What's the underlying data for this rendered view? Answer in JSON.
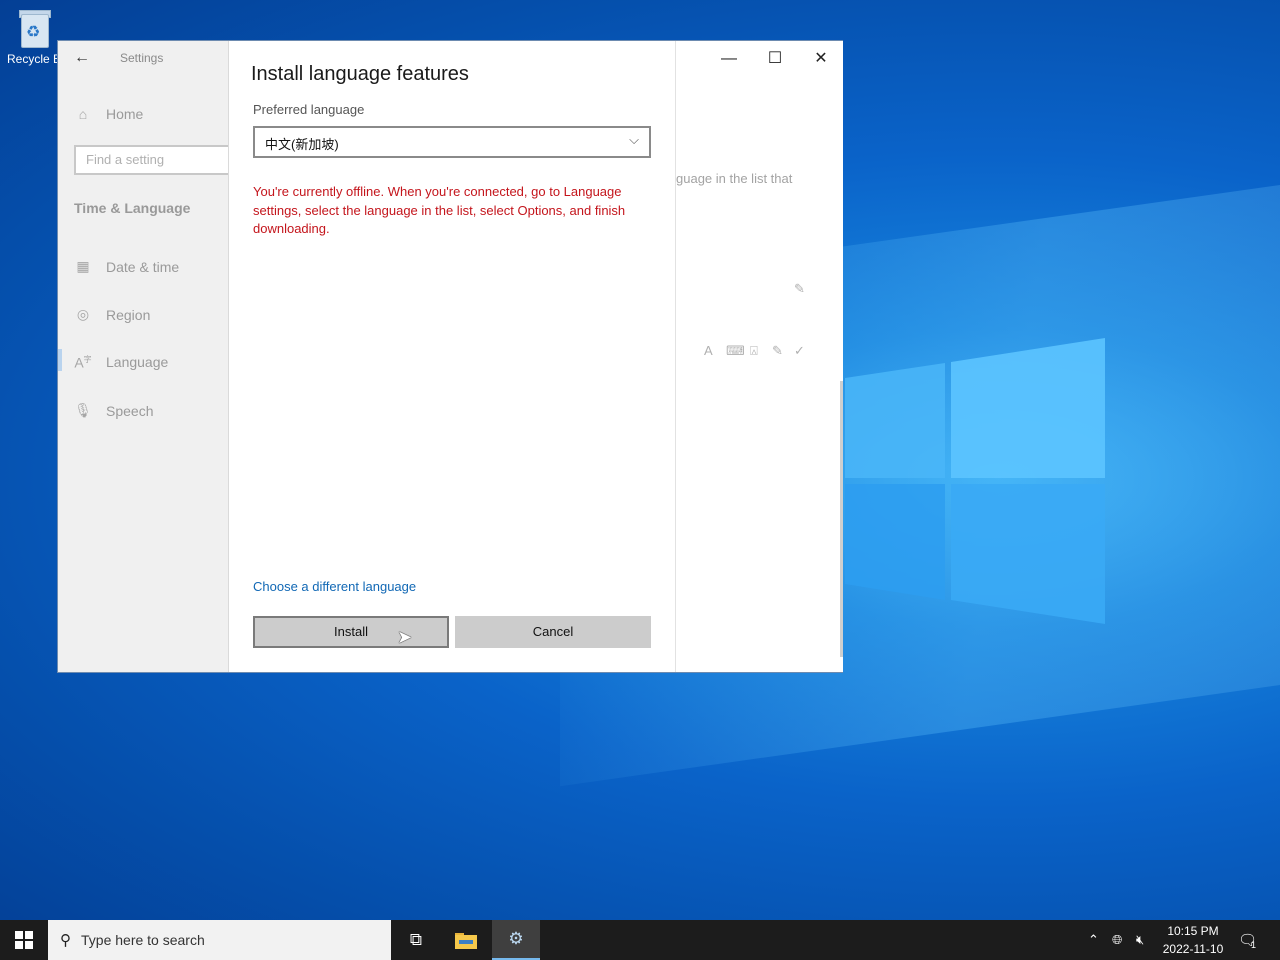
{
  "desktop": {
    "icons": [
      {
        "label": "Recycle Bin",
        "visible_label": "Recycle B"
      }
    ]
  },
  "settings": {
    "app_title": "Settings",
    "back_icon": "back-arrow-icon",
    "search_placeholder": "Find a setting",
    "home_label": "Home",
    "section_title": "Time & Language",
    "nav_items": [
      {
        "label": "Date & time",
        "icon": "calendar-clock-icon"
      },
      {
        "label": "Region",
        "icon": "globe-icon"
      },
      {
        "label": "Language",
        "icon": "language-icon",
        "selected": true
      },
      {
        "label": "Speech",
        "icon": "microphone-icon"
      }
    ],
    "window_controls": {
      "minimize": "—",
      "maximize": "☐",
      "close": "✕"
    },
    "background_text": "guage in the list that"
  },
  "dialog": {
    "title": "Install language features",
    "preferred_label": "Preferred language",
    "selected_language": "中文(新加坡)",
    "offline_message": "You're currently offline. When you're connected, go to Language settings, select the language in the list, select Options, and finish downloading.",
    "change_link": "Choose a different language",
    "install_button": "Install",
    "cancel_button": "Cancel",
    "error_color": "#c4151c",
    "link_color": "#1168b5"
  },
  "taskbar": {
    "search_placeholder": "Type here to search",
    "time": "10:15 PM",
    "date": "2022-11-10",
    "notification_count": "1"
  }
}
